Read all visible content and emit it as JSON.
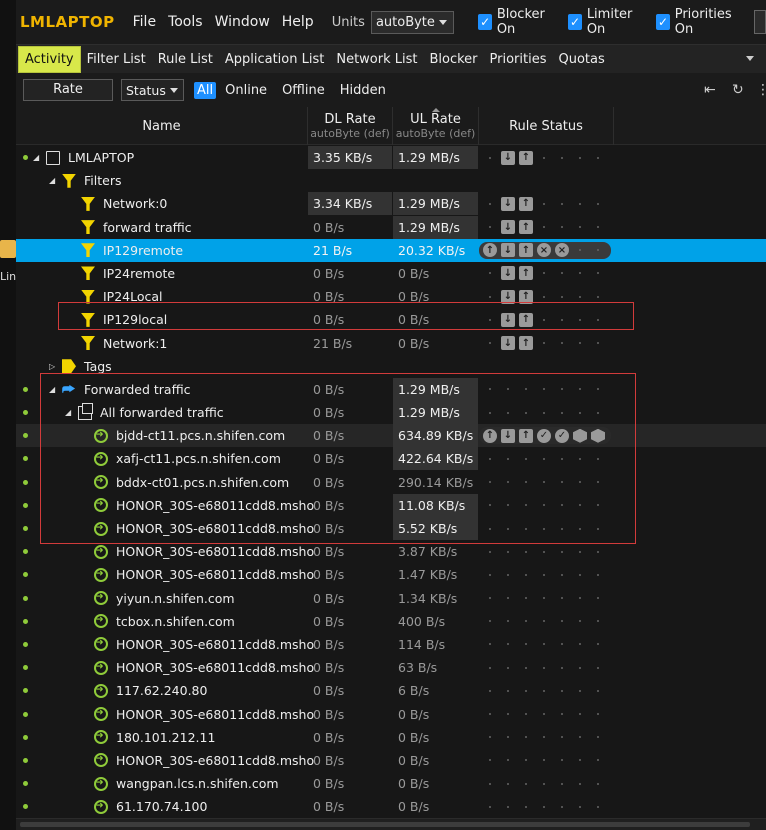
{
  "desktop": {
    "label": "Lin"
  },
  "app": {
    "title": "LMLAPTOP"
  },
  "menu": [
    "File",
    "Tools",
    "Window",
    "Help"
  ],
  "units": {
    "label": "Units",
    "value": "autoByte"
  },
  "toggles": [
    {
      "label": "Blocker On",
      "checked": true
    },
    {
      "label": "Limiter On",
      "checked": true
    },
    {
      "label": "Priorities On",
      "checked": true
    }
  ],
  "tabs": [
    "Activity",
    "Filter List",
    "Rule List",
    "Application List",
    "Network List",
    "Blocker",
    "Priorities",
    "Quotas"
  ],
  "active_tab": "Activity",
  "filterbar": {
    "rate": "Rate",
    "status": "Status",
    "segments": [
      "All",
      "Online",
      "Offline",
      "Hidden"
    ]
  },
  "columns": {
    "name": "Name",
    "dl": "DL Rate",
    "dl_sub": "autoByte (def)",
    "ul": "UL Rate",
    "ul_sub": "autoByte (def)",
    "rule": "Rule Status"
  },
  "rows": [
    {
      "name": "LMLAPTOP",
      "icon": "monitor-icon",
      "dl": "3.35 KB/s",
      "ul": "1.29 MB/s"
    },
    {
      "name": "Filters",
      "icon": "funnel-icon",
      "dl": "",
      "ul": ""
    },
    {
      "name": "Network:0",
      "icon": "funnel-icon",
      "dl": "3.34 KB/s",
      "ul": "1.29 MB/s"
    },
    {
      "name": "forward traffic",
      "icon": "funnel-icon",
      "dl": "0 B/s",
      "ul": "1.29 MB/s"
    },
    {
      "name": "IP129remote",
      "icon": "funnel-icon",
      "dl": "21 B/s",
      "ul": "20.32 KB/s"
    },
    {
      "name": "IP24remote",
      "icon": "funnel-icon",
      "dl": "0 B/s",
      "ul": "0 B/s"
    },
    {
      "name": "IP24Local",
      "icon": "funnel-icon",
      "dl": "0 B/s",
      "ul": "0 B/s"
    },
    {
      "name": "IP129local",
      "icon": "funnel-icon",
      "dl": "0 B/s",
      "ul": "0 B/s"
    },
    {
      "name": "Network:1",
      "icon": "funnel-icon",
      "dl": "21 B/s",
      "ul": "0 B/s"
    },
    {
      "name": "Tags",
      "icon": "tag-icon",
      "dl": "",
      "ul": ""
    },
    {
      "name": "Forwarded traffic",
      "icon": "forward-icon",
      "dl": "0 B/s",
      "ul": "1.29 MB/s"
    },
    {
      "name": "All forwarded traffic",
      "icon": "pages-icon",
      "dl": "0 B/s",
      "ul": "1.29 MB/s"
    },
    {
      "name": "bjdd-ct11.pcs.n.shifen.com",
      "icon": "arrow-circle-icon",
      "dl": "0 B/s",
      "ul": "634.89 KB/s"
    },
    {
      "name": "xafj-ct11.pcs.n.shifen.com",
      "icon": "arrow-circle-icon",
      "dl": "0 B/s",
      "ul": "422.64 KB/s"
    },
    {
      "name": "bddx-ct01.pcs.n.shifen.com",
      "icon": "arrow-circle-icon",
      "dl": "0 B/s",
      "ul": "290.14 KB/s"
    },
    {
      "name": "HONOR_30S-e68011cdd8.msho",
      "icon": "arrow-circle-icon",
      "dl": "0 B/s",
      "ul": "11.08 KB/s"
    },
    {
      "name": "HONOR_30S-e68011cdd8.msho",
      "icon": "arrow-circle-icon",
      "dl": "0 B/s",
      "ul": "5.52 KB/s"
    },
    {
      "name": "HONOR_30S-e68011cdd8.msho",
      "icon": "arrow-circle-icon",
      "dl": "0 B/s",
      "ul": "3.87 KB/s"
    },
    {
      "name": "HONOR_30S-e68011cdd8.msho",
      "icon": "arrow-circle-icon",
      "dl": "0 B/s",
      "ul": "1.47 KB/s"
    },
    {
      "name": "yiyun.n.shifen.com",
      "icon": "arrow-circle-icon",
      "dl": "0 B/s",
      "ul": "1.34 KB/s"
    },
    {
      "name": "tcbox.n.shifen.com",
      "icon": "arrow-circle-icon",
      "dl": "0 B/s",
      "ul": "400 B/s"
    },
    {
      "name": "HONOR_30S-e68011cdd8.msho",
      "icon": "arrow-circle-icon",
      "dl": "0 B/s",
      "ul": "114 B/s"
    },
    {
      "name": "HONOR_30S-e68011cdd8.msho",
      "icon": "arrow-circle-icon",
      "dl": "0 B/s",
      "ul": "63 B/s"
    },
    {
      "name": "117.62.240.80",
      "icon": "arrow-circle-icon",
      "dl": "0 B/s",
      "ul": "6 B/s"
    },
    {
      "name": "HONOR_30S-e68011cdd8.msho",
      "icon": "arrow-circle-icon",
      "dl": "0 B/s",
      "ul": "0 B/s"
    },
    {
      "name": "180.101.212.11",
      "icon": "arrow-circle-icon",
      "dl": "0 B/s",
      "ul": "0 B/s"
    },
    {
      "name": "HONOR_30S-e68011cdd8.msho",
      "icon": "arrow-circle-icon",
      "dl": "0 B/s",
      "ul": "0 B/s"
    },
    {
      "name": "wangpan.lcs.n.shifen.com",
      "icon": "arrow-circle-icon",
      "dl": "0 B/s",
      "ul": "0 B/s"
    },
    {
      "name": "61.170.74.100",
      "icon": "arrow-circle-icon",
      "dl": "0 B/s",
      "ul": "0 B/s"
    }
  ],
  "colors": {
    "accent": "#f0b400",
    "active_tab": "#d8e84a",
    "selection": "#00a2e8",
    "annotation": "#d23b3b",
    "online": "#8fcb3a"
  }
}
